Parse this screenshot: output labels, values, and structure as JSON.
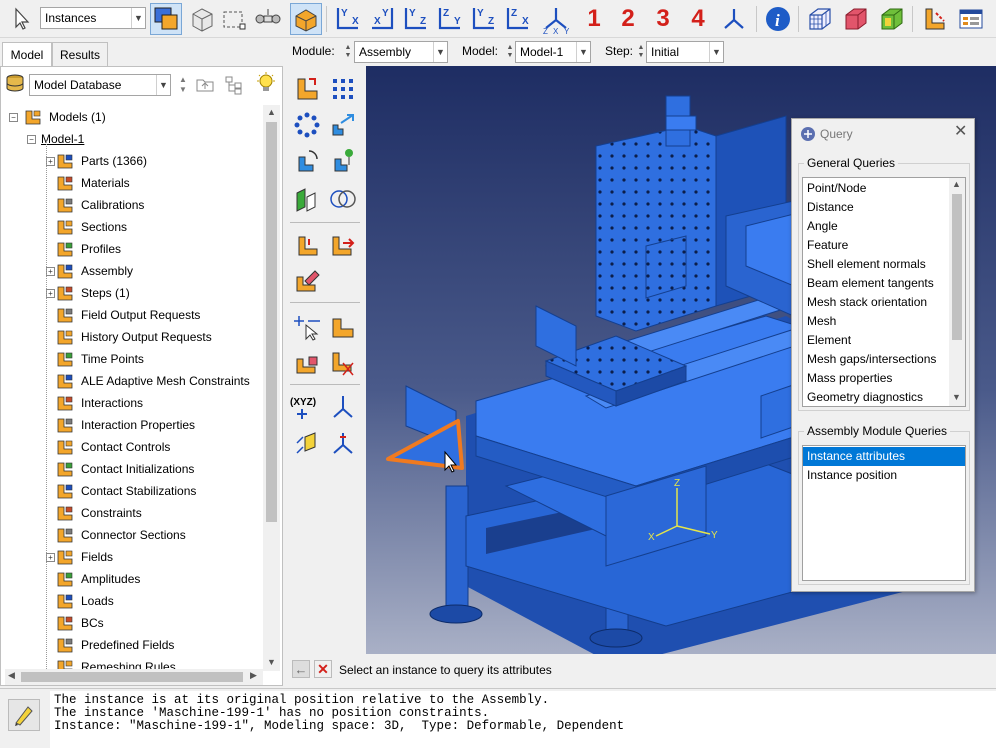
{
  "toolbar": {
    "selection_filter": "Instances",
    "view_numbers": [
      "1",
      "2",
      "3",
      "4"
    ],
    "icons": [
      "select-arrow-icon",
      "select-from-interior-icon",
      "select-from-exterior-icon",
      "drag-shape-icon",
      "selection-options-icon",
      "bounding-box-icon",
      "view-xy-icon",
      "view-yx-icon",
      "view-yz-icon",
      "view-zy-icon",
      "view-zx-icon",
      "view-xz-icon",
      "view-iso-icon",
      "query-info-icon",
      "render-wireframe-icon",
      "render-hidden-icon",
      "render-shaded-icon",
      "section-icon",
      "display-group-icon"
    ]
  },
  "module_bar": {
    "module_label": "Module:",
    "module_value": "Assembly",
    "model_label": "Model:",
    "model_value": "Model-1",
    "step_label": "Step:",
    "step_value": "Initial"
  },
  "left_tabs": [
    "Model",
    "Results"
  ],
  "tree_header": "Model Database",
  "tree": [
    {
      "label": "Models (1)",
      "level": 0,
      "expander": "-",
      "icon": "models-icon"
    },
    {
      "label": "Model-1",
      "level": 1,
      "expander": "-",
      "icon": "",
      "underline": true
    },
    {
      "label": "Parts (1366)",
      "level": 2,
      "expander": "+",
      "icon": "parts-icon"
    },
    {
      "label": "Materials",
      "level": 2,
      "expander": "",
      "icon": "materials-icon"
    },
    {
      "label": "Calibrations",
      "level": 2,
      "expander": "",
      "icon": "calibrations-icon"
    },
    {
      "label": "Sections",
      "level": 2,
      "expander": "",
      "icon": "sections-icon"
    },
    {
      "label": "Profiles",
      "level": 2,
      "expander": "",
      "icon": "profiles-icon"
    },
    {
      "label": "Assembly",
      "level": 2,
      "expander": "+",
      "icon": "assembly-icon"
    },
    {
      "label": "Steps (1)",
      "level": 2,
      "expander": "+",
      "icon": "steps-icon"
    },
    {
      "label": "Field Output Requests",
      "level": 2,
      "expander": "",
      "icon": "field-output-icon"
    },
    {
      "label": "History Output Requests",
      "level": 2,
      "expander": "",
      "icon": "history-output-icon"
    },
    {
      "label": "Time Points",
      "level": 2,
      "expander": "",
      "icon": "time-points-icon"
    },
    {
      "label": "ALE Adaptive Mesh Constraints",
      "level": 2,
      "expander": "",
      "icon": "ale-mesh-icon"
    },
    {
      "label": "Interactions",
      "level": 2,
      "expander": "",
      "icon": "interactions-icon"
    },
    {
      "label": "Interaction Properties",
      "level": 2,
      "expander": "",
      "icon": "interaction-properties-icon"
    },
    {
      "label": "Contact Controls",
      "level": 2,
      "expander": "",
      "icon": "contact-controls-icon"
    },
    {
      "label": "Contact Initializations",
      "level": 2,
      "expander": "",
      "icon": "contact-initializations-icon"
    },
    {
      "label": "Contact Stabilizations",
      "level": 2,
      "expander": "",
      "icon": "contact-stabilizations-icon"
    },
    {
      "label": "Constraints",
      "level": 2,
      "expander": "",
      "icon": "constraints-icon"
    },
    {
      "label": "Connector Sections",
      "level": 2,
      "expander": "",
      "icon": "connector-sections-icon"
    },
    {
      "label": "Fields",
      "level": 2,
      "expander": "+",
      "icon": "fields-icon"
    },
    {
      "label": "Amplitudes",
      "level": 2,
      "expander": "",
      "icon": "amplitudes-icon"
    },
    {
      "label": "Loads",
      "level": 2,
      "expander": "",
      "icon": "loads-icon"
    },
    {
      "label": "BCs",
      "level": 2,
      "expander": "",
      "icon": "bcs-icon"
    },
    {
      "label": "Predefined Fields",
      "level": 2,
      "expander": "",
      "icon": "predefined-fields-icon"
    },
    {
      "label": "Remeshing Rules",
      "level": 2,
      "expander": "",
      "icon": "remeshing-rules-icon"
    }
  ],
  "query": {
    "title": "Query",
    "general_label": "General Queries",
    "general_items": [
      "Point/Node",
      "Distance",
      "Angle",
      "Feature",
      "Shell element normals",
      "Beam element tangents",
      "Mesh stack orientation",
      "Mesh",
      "Element",
      "Mesh gaps/intersections",
      "Mass properties",
      "Geometry diagnostics"
    ],
    "assembly_label": "Assembly Module Queries",
    "assembly_items": [
      "Instance attributes",
      "Instance position"
    ],
    "selected_assembly_item": "Instance attributes"
  },
  "prompt": {
    "text": "Select an instance to query its attributes"
  },
  "triad": {
    "x": "X",
    "y": "Y",
    "z": "Z"
  },
  "messages": [
    "The instance is at its original position relative to the Assembly.",
    "The instance 'Maschine-199-1' has no position constraints.",
    "Instance: \"Maschine-199-1\", Modeling space: 3D,  Type: Deformable, Dependent"
  ],
  "colors": {
    "model_blue": "#2f6fe0",
    "highlight_orange": "#f07a20",
    "selection_blue": "#0078d7"
  }
}
